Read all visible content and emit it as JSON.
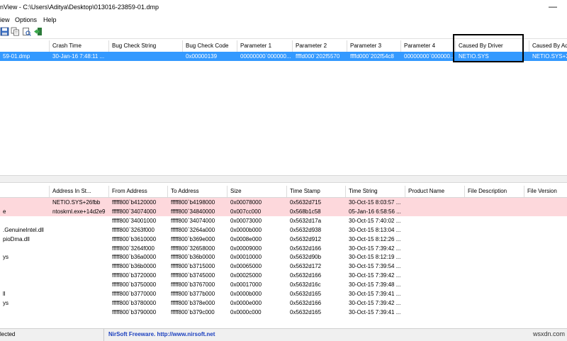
{
  "window": {
    "title": "nView - C:\\Users\\Aditya\\Desktop\\013016-23859-01.dmp",
    "minimize_glyph": "—"
  },
  "menu": [
    "iew",
    "Options",
    "Help"
  ],
  "toolbar_icons": [
    "save-icon",
    "copy-icon",
    "properties-icon",
    "exit-icon"
  ],
  "crash_list": {
    "columns": [
      "",
      "Crash Time",
      "Bug Check String",
      "Bug Check Code",
      "Parameter 1",
      "Parameter 2",
      "Parameter 3",
      "Parameter 4",
      "Caused By Driver",
      "Caused By Ad"
    ],
    "rows": [
      [
        "59-01.dmp",
        "30-Jan-16 7:48:11 ...",
        "",
        "0x00000139",
        "00000000`000000...",
        "ffffd000`202f5570",
        "ffffd000`202f54c8",
        "00000000`000000...",
        "NETIO.SYS",
        "NETIO.SYS+2..."
      ]
    ]
  },
  "driver_list": {
    "columns": [
      "",
      "Address In St...",
      "From Address",
      "To Address",
      "Size",
      "Time Stamp",
      "Time String",
      "Product Name",
      "File Description",
      "File Version"
    ],
    "rows": [
      [
        "",
        "NETIO.SYS+26fbb",
        "fffff800`b4120000",
        "fffff800`b4198000",
        "0x00078000",
        "0x5632d715",
        "30-Oct-15 8:03:57 ...",
        "",
        "",
        ""
      ],
      [
        "e",
        "ntoskrnl.exe+14d2e9",
        "fffff800`34074000",
        "fffff800`34840000",
        "0x007cc000",
        "0x568b1c58",
        "05-Jan-16 6:58:56 ...",
        "",
        "",
        ""
      ],
      [
        "",
        "",
        "fffff800`34001000",
        "fffff800`34074000",
        "0x00073000",
        "0x5632d17a",
        "30-Oct-15 7:40:02 ...",
        "",
        "",
        ""
      ],
      [
        ".GenuineIntel.dll",
        "",
        "fffff800`3263f000",
        "fffff800`3264a000",
        "0x0000b000",
        "0x5632d938",
        "30-Oct-15 8:13:04 ...",
        "",
        "",
        ""
      ],
      [
        "pioDma.dll",
        "",
        "fffff800`b3610000",
        "fffff800`b369e000",
        "0x0008e000",
        "0x5632d912",
        "30-Oct-15 8:12:26 ...",
        "",
        "",
        ""
      ],
      [
        "",
        "",
        "fffff800`3264f000",
        "fffff800`32658000",
        "0x00009000",
        "0x5632d166",
        "30-Oct-15 7:39:42 ...",
        "",
        "",
        ""
      ],
      [
        "ys",
        "",
        "fffff800`b36a0000",
        "fffff800`b36b0000",
        "0x00010000",
        "0x5632d90b",
        "30-Oct-15 8:12:19 ...",
        "",
        "",
        ""
      ],
      [
        "",
        "",
        "fffff800`b36b0000",
        "fffff800`b3715000",
        "0x00065000",
        "0x5632d172",
        "30-Oct-15 7:39:54 ...",
        "",
        "",
        ""
      ],
      [
        "",
        "",
        "fffff800`b3720000",
        "fffff800`b3745000",
        "0x00025000",
        "0x5632d166",
        "30-Oct-15 7:39:42 ...",
        "",
        "",
        ""
      ],
      [
        "",
        "",
        "fffff800`b3750000",
        "fffff800`b3767000",
        "0x00017000",
        "0x5632d16c",
        "30-Oct-15 7:39:48 ...",
        "",
        "",
        ""
      ],
      [
        "ll",
        "",
        "fffff800`b3770000",
        "fffff800`b377b000",
        "0x0000b000",
        "0x5632d165",
        "30-Oct-15 7:39:41 ...",
        "",
        "",
        ""
      ],
      [
        "ys",
        "",
        "fffff800`b3780000",
        "fffff800`b378e000",
        "0x0000e000",
        "0x5632d166",
        "30-Oct-15 7:39:42 ...",
        "",
        "",
        ""
      ],
      [
        "",
        "",
        "fffff800`b3790000",
        "fffff800`b379c000",
        "0x0000c000",
        "0x5632d165",
        "30-Oct-15 7:39:41 ...",
        "",
        "",
        ""
      ]
    ]
  },
  "status": {
    "selected": "lected",
    "credit": "NirSoft Freeware.  http://www.nirsoft.net"
  },
  "watermark": "wsxdn.com",
  "colors": {
    "selection": "#3399ff",
    "highlight_row": "#fdd8dc",
    "annotation_box": "#000000",
    "link": "#1a3fbf"
  }
}
